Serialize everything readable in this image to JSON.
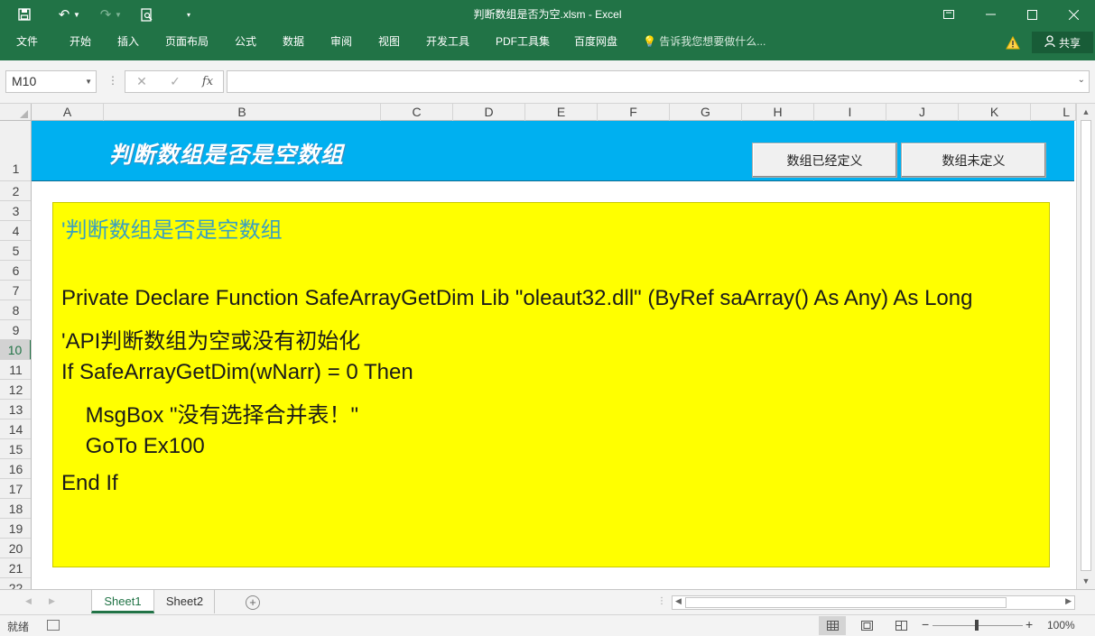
{
  "window": {
    "title": "判断数组是否为空.xlsm - Excel"
  },
  "ribbon": {
    "tabs": [
      "文件",
      "开始",
      "插入",
      "页面布局",
      "公式",
      "数据",
      "审阅",
      "视图",
      "开发工具",
      "PDF工具集",
      "百度网盘"
    ],
    "tell_me": "告诉我您想要做什么...",
    "share": "共享"
  },
  "formula_bar": {
    "name_box": "M10",
    "formula": ""
  },
  "columns": [
    "A",
    "B",
    "C",
    "D",
    "E",
    "F",
    "G",
    "H",
    "I",
    "J",
    "K",
    "L"
  ],
  "rows": [
    "1",
    "2",
    "3",
    "4",
    "5",
    "6",
    "7",
    "8",
    "9",
    "10",
    "11",
    "12",
    "13",
    "14",
    "15",
    "16",
    "17",
    "18",
    "19",
    "20",
    "21",
    "22"
  ],
  "selected_row": "10",
  "sheet": {
    "header_title": "判断数组是否是空数组",
    "buttons": [
      "数组已经定义",
      "数组未定义"
    ],
    "code": [
      {
        "text": "'判断数组是否是空数组",
        "type": "comment"
      },
      {
        "text": "",
        "type": "code"
      },
      {
        "text": "Private Declare Function SafeArrayGetDim Lib \"oleaut32.dll\" (ByRef saArray() As Any) As Long",
        "type": "code"
      },
      {
        "text": "'API判断数组为空或没有初始化",
        "type": "code"
      },
      {
        "text": "If SafeArrayGetDim(wNarr) = 0 Then",
        "type": "code"
      },
      {
        "text": "    MsgBox \"没有选择合并表！\"",
        "type": "code"
      },
      {
        "text": "    GoTo Ex100",
        "type": "code"
      },
      {
        "text": "End If",
        "type": "code"
      }
    ]
  },
  "sheet_tabs": [
    "Sheet1",
    "Sheet2"
  ],
  "active_sheet": "Sheet1",
  "status": {
    "ready": "就绪",
    "zoom": "100%"
  },
  "colors": {
    "excel_green": "#217346",
    "banner_blue": "#00b0f0",
    "code_yellow": "#ffff00",
    "comment": "#3aa0c0"
  }
}
